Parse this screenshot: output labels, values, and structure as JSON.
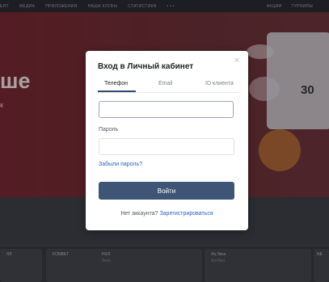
{
  "topnav": {
    "items": [
      "ЕНТ",
      "МЕДИА",
      "ПРИЛОЖЕНИЯ",
      "НАШИ КЛУБЫ",
      "СТАТИСТИКА",
      "• • •"
    ],
    "right_items": [
      "АКЦИИ",
      "ТУРНИРЫ"
    ]
  },
  "hero": {
    "headline": "ше",
    "sub": "к"
  },
  "cards": [
    {
      "label": "ЛЛ",
      "sub": ""
    },
    {
      "label": "FONBET",
      "sub": ""
    },
    {
      "label": "НХЛ",
      "sub": "Лига"
    },
    {
      "label": "Ла Лига",
      "sub": "Футбол"
    },
    {
      "label": "NE",
      "sub": ""
    }
  ],
  "jersey_number": "30",
  "modal": {
    "title": "Вход в Личный кабинет",
    "close_icon": "×",
    "tabs": [
      {
        "label": "Телефон",
        "active": true
      },
      {
        "label": "Email",
        "active": false
      },
      {
        "label": "ID клиента",
        "active": false
      }
    ],
    "phone": {
      "value": "",
      "placeholder": ""
    },
    "password": {
      "label": "Пароль",
      "value": "",
      "placeholder": ""
    },
    "forgot_label": "Забыли пароль?",
    "login_label": "Войти",
    "no_account_text": "Нет аккаунта?",
    "register_label": "Зарегистрироваться"
  },
  "colors": {
    "primary_button": "#3e5576",
    "link": "#2a63b5",
    "active_tab_underline": "#2e4a6f"
  }
}
